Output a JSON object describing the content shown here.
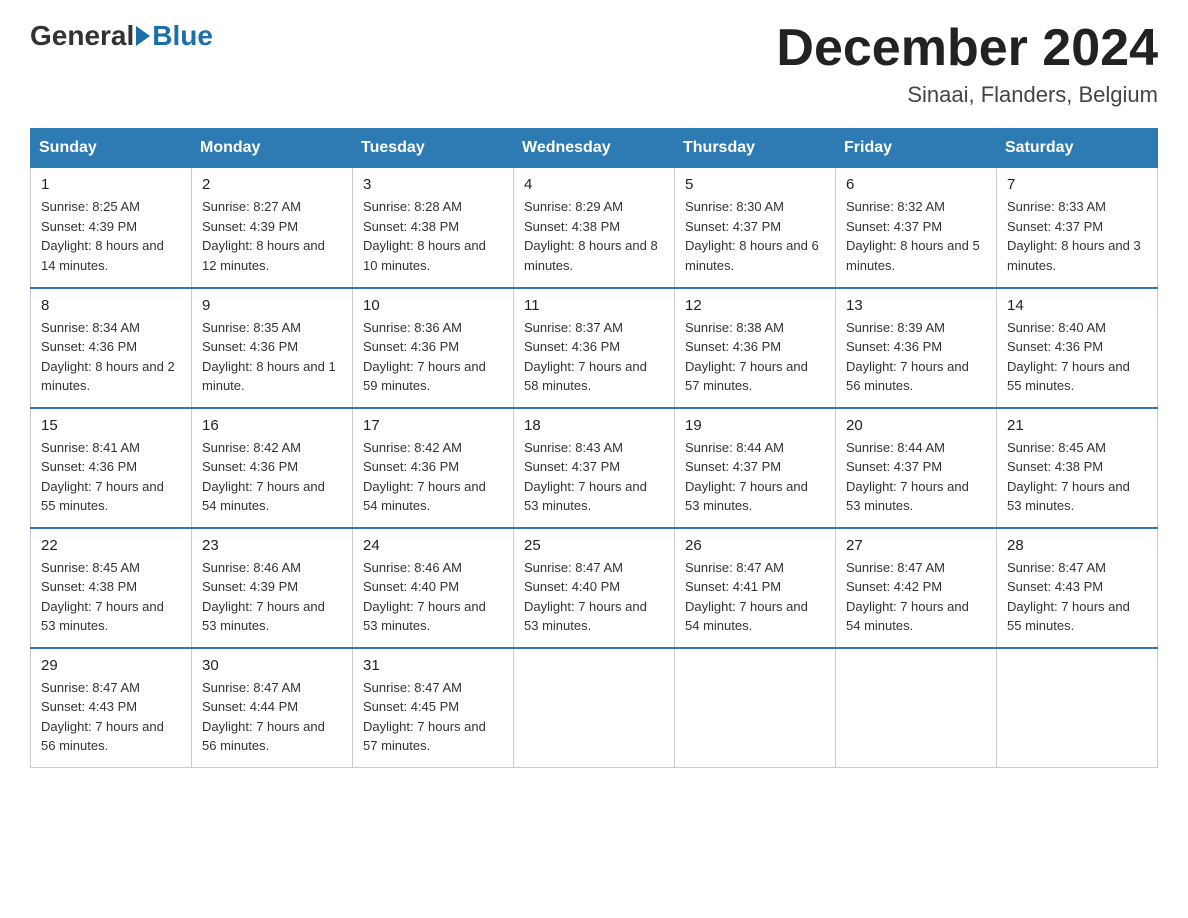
{
  "header": {
    "logo": {
      "text_before": "General",
      "text_after": "Blue"
    },
    "title": "December 2024",
    "location": "Sinaai, Flanders, Belgium"
  },
  "days_of_week": [
    "Sunday",
    "Monday",
    "Tuesday",
    "Wednesday",
    "Thursday",
    "Friday",
    "Saturday"
  ],
  "weeks": [
    [
      {
        "day": "1",
        "sunrise": "8:25 AM",
        "sunset": "4:39 PM",
        "daylight": "8 hours and 14 minutes."
      },
      {
        "day": "2",
        "sunrise": "8:27 AM",
        "sunset": "4:39 PM",
        "daylight": "8 hours and 12 minutes."
      },
      {
        "day": "3",
        "sunrise": "8:28 AM",
        "sunset": "4:38 PM",
        "daylight": "8 hours and 10 minutes."
      },
      {
        "day": "4",
        "sunrise": "8:29 AM",
        "sunset": "4:38 PM",
        "daylight": "8 hours and 8 minutes."
      },
      {
        "day": "5",
        "sunrise": "8:30 AM",
        "sunset": "4:37 PM",
        "daylight": "8 hours and 6 minutes."
      },
      {
        "day": "6",
        "sunrise": "8:32 AM",
        "sunset": "4:37 PM",
        "daylight": "8 hours and 5 minutes."
      },
      {
        "day": "7",
        "sunrise": "8:33 AM",
        "sunset": "4:37 PM",
        "daylight": "8 hours and 3 minutes."
      }
    ],
    [
      {
        "day": "8",
        "sunrise": "8:34 AM",
        "sunset": "4:36 PM",
        "daylight": "8 hours and 2 minutes."
      },
      {
        "day": "9",
        "sunrise": "8:35 AM",
        "sunset": "4:36 PM",
        "daylight": "8 hours and 1 minute."
      },
      {
        "day": "10",
        "sunrise": "8:36 AM",
        "sunset": "4:36 PM",
        "daylight": "7 hours and 59 minutes."
      },
      {
        "day": "11",
        "sunrise": "8:37 AM",
        "sunset": "4:36 PM",
        "daylight": "7 hours and 58 minutes."
      },
      {
        "day": "12",
        "sunrise": "8:38 AM",
        "sunset": "4:36 PM",
        "daylight": "7 hours and 57 minutes."
      },
      {
        "day": "13",
        "sunrise": "8:39 AM",
        "sunset": "4:36 PM",
        "daylight": "7 hours and 56 minutes."
      },
      {
        "day": "14",
        "sunrise": "8:40 AM",
        "sunset": "4:36 PM",
        "daylight": "7 hours and 55 minutes."
      }
    ],
    [
      {
        "day": "15",
        "sunrise": "8:41 AM",
        "sunset": "4:36 PM",
        "daylight": "7 hours and 55 minutes."
      },
      {
        "day": "16",
        "sunrise": "8:42 AM",
        "sunset": "4:36 PM",
        "daylight": "7 hours and 54 minutes."
      },
      {
        "day": "17",
        "sunrise": "8:42 AM",
        "sunset": "4:36 PM",
        "daylight": "7 hours and 54 minutes."
      },
      {
        "day": "18",
        "sunrise": "8:43 AM",
        "sunset": "4:37 PM",
        "daylight": "7 hours and 53 minutes."
      },
      {
        "day": "19",
        "sunrise": "8:44 AM",
        "sunset": "4:37 PM",
        "daylight": "7 hours and 53 minutes."
      },
      {
        "day": "20",
        "sunrise": "8:44 AM",
        "sunset": "4:37 PM",
        "daylight": "7 hours and 53 minutes."
      },
      {
        "day": "21",
        "sunrise": "8:45 AM",
        "sunset": "4:38 PM",
        "daylight": "7 hours and 53 minutes."
      }
    ],
    [
      {
        "day": "22",
        "sunrise": "8:45 AM",
        "sunset": "4:38 PM",
        "daylight": "7 hours and 53 minutes."
      },
      {
        "day": "23",
        "sunrise": "8:46 AM",
        "sunset": "4:39 PM",
        "daylight": "7 hours and 53 minutes."
      },
      {
        "day": "24",
        "sunrise": "8:46 AM",
        "sunset": "4:40 PM",
        "daylight": "7 hours and 53 minutes."
      },
      {
        "day": "25",
        "sunrise": "8:47 AM",
        "sunset": "4:40 PM",
        "daylight": "7 hours and 53 minutes."
      },
      {
        "day": "26",
        "sunrise": "8:47 AM",
        "sunset": "4:41 PM",
        "daylight": "7 hours and 54 minutes."
      },
      {
        "day": "27",
        "sunrise": "8:47 AM",
        "sunset": "4:42 PM",
        "daylight": "7 hours and 54 minutes."
      },
      {
        "day": "28",
        "sunrise": "8:47 AM",
        "sunset": "4:43 PM",
        "daylight": "7 hours and 55 minutes."
      }
    ],
    [
      {
        "day": "29",
        "sunrise": "8:47 AM",
        "sunset": "4:43 PM",
        "daylight": "7 hours and 56 minutes."
      },
      {
        "day": "30",
        "sunrise": "8:47 AM",
        "sunset": "4:44 PM",
        "daylight": "7 hours and 56 minutes."
      },
      {
        "day": "31",
        "sunrise": "8:47 AM",
        "sunset": "4:45 PM",
        "daylight": "7 hours and 57 minutes."
      },
      null,
      null,
      null,
      null
    ]
  ],
  "labels": {
    "sunrise_prefix": "Sunrise: ",
    "sunset_prefix": "Sunset: ",
    "daylight_prefix": "Daylight: "
  }
}
